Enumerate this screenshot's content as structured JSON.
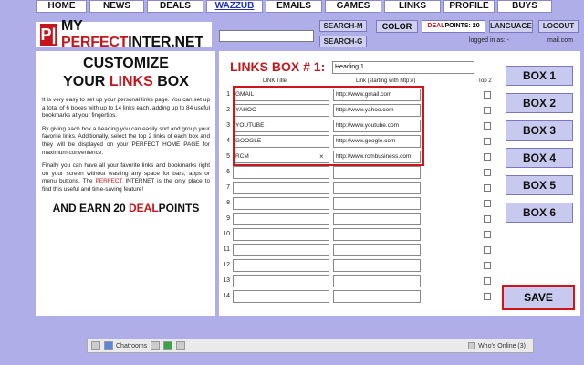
{
  "nav": [
    "HOME",
    "NEWS",
    "DEALS",
    "WAZZUB",
    "EMAILS",
    "GAMES",
    "LINKS",
    "PROFILE",
    "BUYS"
  ],
  "logo": {
    "mark": "P|",
    "my": "MY",
    "perfect": "PERFECT",
    "rest": "INTER.NET"
  },
  "header": {
    "search_m": "SEARCH-M",
    "search_g": "SEARCH-G",
    "color": "COLOR",
    "dealpoints_label": "DEALPOINTS: 20",
    "dealpoints_deal": "DEAL",
    "dealpoints_rest": "POINTS: 20",
    "language": "LANGUAGE",
    "logout": "LOGOUT",
    "logged_in": "logged in as:",
    "logged_in_dash": "-",
    "logged_in_user": "mail.com"
  },
  "info": {
    "title1": "CUSTOMIZE",
    "title2_a": "YOUR ",
    "title2_b": "LINKS",
    "title2_c": " BOX",
    "p1": "It is very easy to set up your personal links page. You can set up a total of 6 boxes with up to 14 links each, adding up to 84 useful bookmarks at your fingertips.",
    "p2": "By giving each box a heading you can easily sort and group your favorite links. Additionally, select the top 2 links of each box and they will be displayed on your PERFECT HOME PAGE for maximum convenience.",
    "p3_a": "Finally you can have all your favorite links and bookmarks right on your screen without wasting any space for bars, apps or menu buttons. The ",
    "p3_red": "PERFECT",
    "p3_b": " INTERNET is the only place to find this useful and time-saving feature!",
    "earn_a": "AND EARN 20 ",
    "earn_red": "DEAL",
    "earn_b": "POINTS"
  },
  "main": {
    "box_title": "LINKS BOX # 1:",
    "heading_value": "Heading 1",
    "col_title": "LINK Title",
    "col_link": "Link (starting with http://)",
    "col_top": "Top 2",
    "rows": [
      {
        "n": "1",
        "title": "GMAIL",
        "link": "http://www.gmail.com"
      },
      {
        "n": "2",
        "title": "YAHOO",
        "link": "http://www.yahoo.com"
      },
      {
        "n": "3",
        "title": "YOUTUBE",
        "link": "http://www.youtube.com"
      },
      {
        "n": "4",
        "title": "GOOGLE",
        "link": "http://www.google.com"
      },
      {
        "n": "5",
        "title": "RCM",
        "link": "http://www.rcmbusiness.com"
      },
      {
        "n": "6",
        "title": "",
        "link": ""
      },
      {
        "n": "7",
        "title": "",
        "link": ""
      },
      {
        "n": "8",
        "title": "",
        "link": ""
      },
      {
        "n": "9",
        "title": "",
        "link": ""
      },
      {
        "n": "10",
        "title": "",
        "link": ""
      },
      {
        "n": "11",
        "title": "",
        "link": ""
      },
      {
        "n": "12",
        "title": "",
        "link": ""
      },
      {
        "n": "13",
        "title": "",
        "link": ""
      },
      {
        "n": "14",
        "title": "",
        "link": ""
      }
    ],
    "clear_glyph": "×",
    "boxes": [
      "BOX 1",
      "BOX 2",
      "BOX 3",
      "BOX 4",
      "BOX 5",
      "BOX 6"
    ],
    "save": "SAVE"
  },
  "taskbar": {
    "chatrooms": "Chatrooms",
    "online": "Who's Online (3)"
  },
  "colors": {
    "accent_red": "#c4161c",
    "background": "#b0aee8",
    "button": "#c8c9ef"
  }
}
